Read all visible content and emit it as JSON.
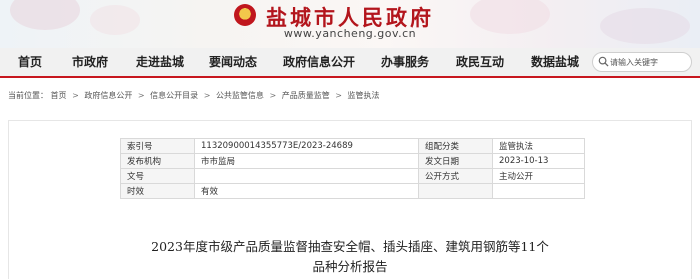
{
  "header": {
    "site_name": "盐城市人民政府",
    "site_url": "www.yancheng.gov.cn"
  },
  "nav": {
    "items": [
      "首页",
      "市政府",
      "走进盐城",
      "要闻动态",
      "政府信息公开",
      "办事服务",
      "政民互动",
      "数据盐城"
    ],
    "search_placeholder": "请输入关键字"
  },
  "breadcrumb": {
    "prefix": "当前位置：",
    "items": [
      "首页",
      "政府信息公开",
      "信息公开目录",
      "公共监管信息",
      "产品质量监管",
      "监管执法"
    ]
  },
  "meta": {
    "rows": [
      {
        "label": "索引号",
        "value": "113209000143557​73E/2023-24689",
        "label2": "组配分类",
        "value2": "监管执法"
      },
      {
        "label": "发布机构",
        "value": "市市监局",
        "label2": "发文日期",
        "value2": "2023-10-13"
      },
      {
        "label": "文号",
        "value": "",
        "label2": "公开方式",
        "value2": "主动公开"
      },
      {
        "label": "时效",
        "value": "有效",
        "label2": "",
        "value2": ""
      }
    ]
  },
  "document": {
    "title_line1": "2023年度市级产品质量监督抽查安全帽、插头插座、建筑用钢筋等11个",
    "title_line2": "品种分析报告"
  },
  "colors": {
    "brand_red": "#b3151c",
    "nav_bg": "#f1f1f1"
  }
}
